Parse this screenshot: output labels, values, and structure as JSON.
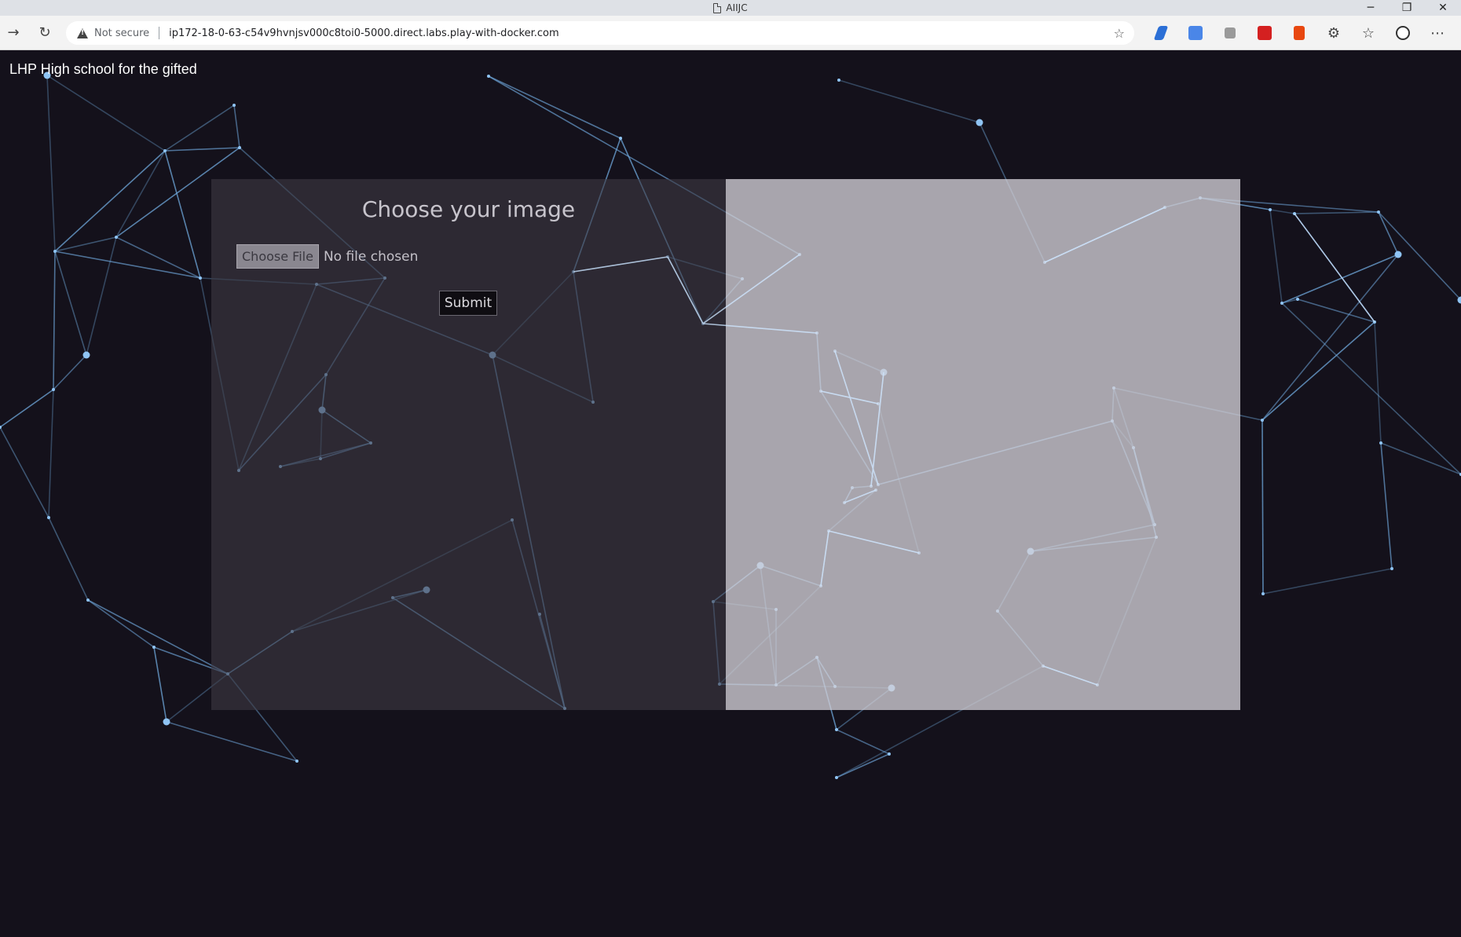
{
  "window": {
    "tab_title": "AIIJC",
    "controls": {
      "minimize": "─",
      "restore": "❐",
      "close": "✕"
    }
  },
  "browser": {
    "security_label": "Not secure",
    "url": "ip172-18-0-63-c54v9hvnjsv000c8toi0-5000.direct.labs.play-with-docker.com",
    "icons": [
      "back-icon",
      "reload-icon",
      "warning-icon",
      "favorites-add-icon",
      "extension-pen-icon",
      "translate-icon",
      "collections-icon",
      "pdf-icon",
      "office-icon",
      "extensions-icon",
      "favorites-icon",
      "profile-icon",
      "more-icon"
    ]
  },
  "page": {
    "brand": "LHP High school for the gifted",
    "upload": {
      "title": "Choose your image",
      "choose_file_label": "Choose File",
      "file_status": "No file chosen",
      "submit_label": "Submit"
    }
  },
  "colors": {
    "background": "#14111b",
    "network_line": "#6fa8dc",
    "upload_panel": "#3e3a44",
    "preview_panel": "#d2d0d6"
  }
}
